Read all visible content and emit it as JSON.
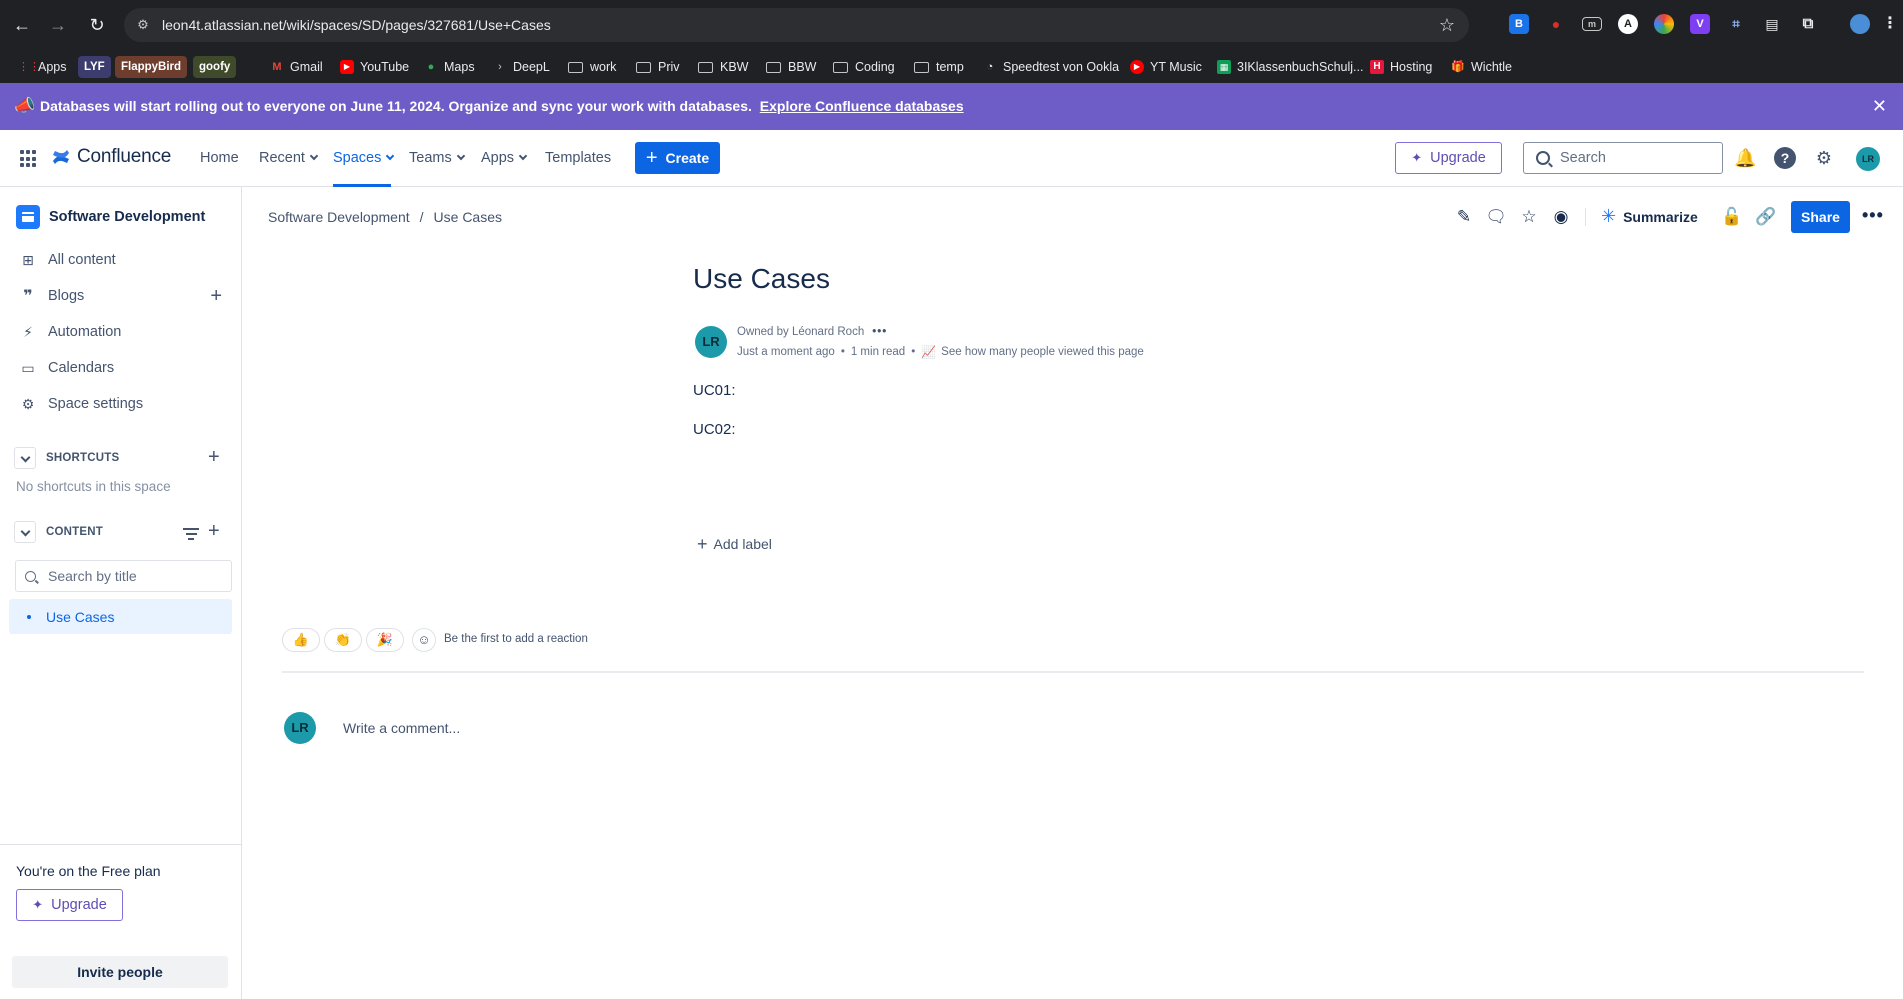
{
  "browser": {
    "url": "leon4t.atlassian.net/wiki/spaces/SD/pages/327681/Use+Cases",
    "bookmarks": [
      "Apps",
      "LYF",
      "FlappyBird",
      "goofy",
      "Gmail",
      "YouTube",
      "Maps",
      "DeepL",
      "work",
      "Priv",
      "KBW",
      "BBW",
      "Coding",
      "temp",
      "Speedtest von Ookla",
      "YT Music",
      "3IKlassenbuchSchulj...",
      "Hosting",
      "Wichtle"
    ]
  },
  "banner": {
    "message": "Databases will start rolling out to everyone on June 11, 2024. Organize and sync your work with databases.",
    "link": "Explore Confluence databases"
  },
  "topnav": {
    "product": "Confluence",
    "items": [
      "Home",
      "Recent",
      "Spaces",
      "Teams",
      "Apps",
      "Templates"
    ],
    "create": "Create",
    "upgrade": "Upgrade",
    "search_placeholder": "Search",
    "avatar_initials": "LR"
  },
  "sidebar": {
    "space_name": "Software Development",
    "items": [
      "All content",
      "Blogs",
      "Automation",
      "Calendars",
      "Space settings"
    ],
    "shortcuts_label": "SHORTCUTS",
    "no_shortcuts": "No shortcuts in this space",
    "content_label": "CONTENT",
    "search_placeholder": "Search by title",
    "tree_item": "Use Cases",
    "free_plan": "You're on the Free plan",
    "upgrade": "Upgrade",
    "invite": "Invite people"
  },
  "page": {
    "breadcrumb": [
      "Software Development",
      "/",
      "Use Cases"
    ],
    "summarize": "Summarize",
    "share": "Share",
    "title": "Use Cases",
    "owner": "Owned by Léonard Roch",
    "time": "Just a moment ago",
    "read_time": "1 min read",
    "views_link": "See how many people viewed this page",
    "avatar_initials": "LR",
    "body": [
      "UC01:",
      "UC02:"
    ],
    "add_label": "Add label",
    "reaction_prompt": "Be the first to add a reaction",
    "comment_placeholder": "Write a comment...",
    "comment_avatar": "LR"
  },
  "colors": {
    "banner": "#6e5dc6",
    "primary": "#0c66e4",
    "avatar": "#1d9aaa"
  }
}
